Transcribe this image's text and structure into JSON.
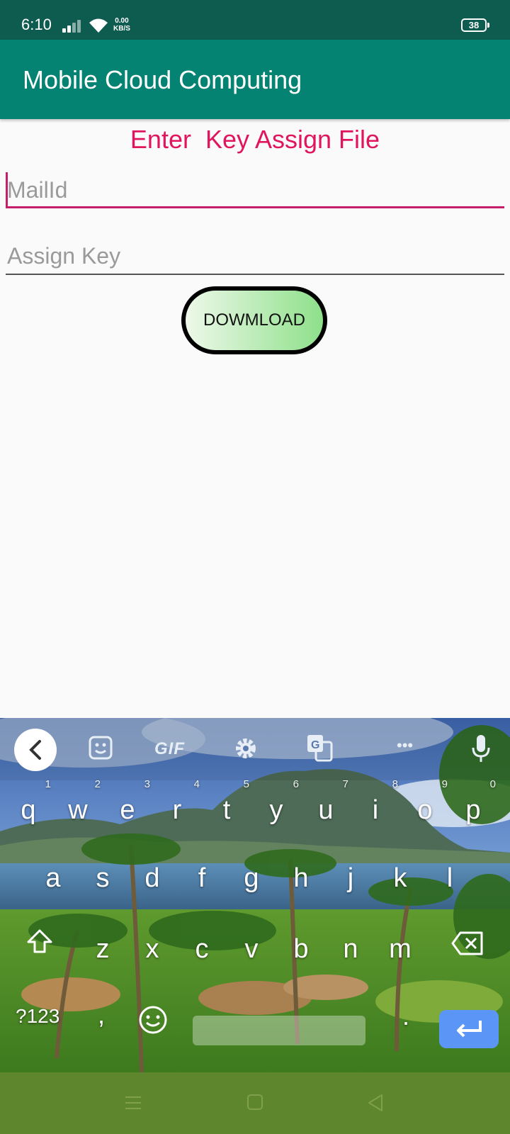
{
  "status_bar": {
    "time": "6:10",
    "speed_value": "0.00",
    "speed_unit": "KB/S",
    "battery": "38"
  },
  "app_bar": {
    "title": "Mobile Cloud Computing"
  },
  "main": {
    "heading": "Enter  Key Assign File",
    "mail_placeholder": "MailId",
    "key_placeholder": "Assign Key",
    "download_label": "DOWMLOAD"
  },
  "keyboard": {
    "toolbar": {
      "gif": "GIF",
      "more": "•••"
    },
    "row1": [
      {
        "k": "q",
        "n": "1"
      },
      {
        "k": "w",
        "n": "2"
      },
      {
        "k": "e",
        "n": "3"
      },
      {
        "k": "r",
        "n": "4"
      },
      {
        "k": "t",
        "n": "5"
      },
      {
        "k": "y",
        "n": "6"
      },
      {
        "k": "u",
        "n": "7"
      },
      {
        "k": "i",
        "n": "8"
      },
      {
        "k": "o",
        "n": "9"
      },
      {
        "k": "p",
        "n": "0"
      }
    ],
    "row2": [
      "a",
      "s",
      "d",
      "f",
      "g",
      "h",
      "j",
      "k",
      "l"
    ],
    "row3": [
      "z",
      "x",
      "c",
      "v",
      "b",
      "n",
      "m"
    ],
    "symbols": "?123",
    "comma": ",",
    "period": "."
  },
  "colors": {
    "app_bar": "#048272",
    "status_bar": "#0e5b4f",
    "accent": "#e0155d",
    "nav_bar": "#5d862d",
    "enter_key": "#5b95f5"
  }
}
